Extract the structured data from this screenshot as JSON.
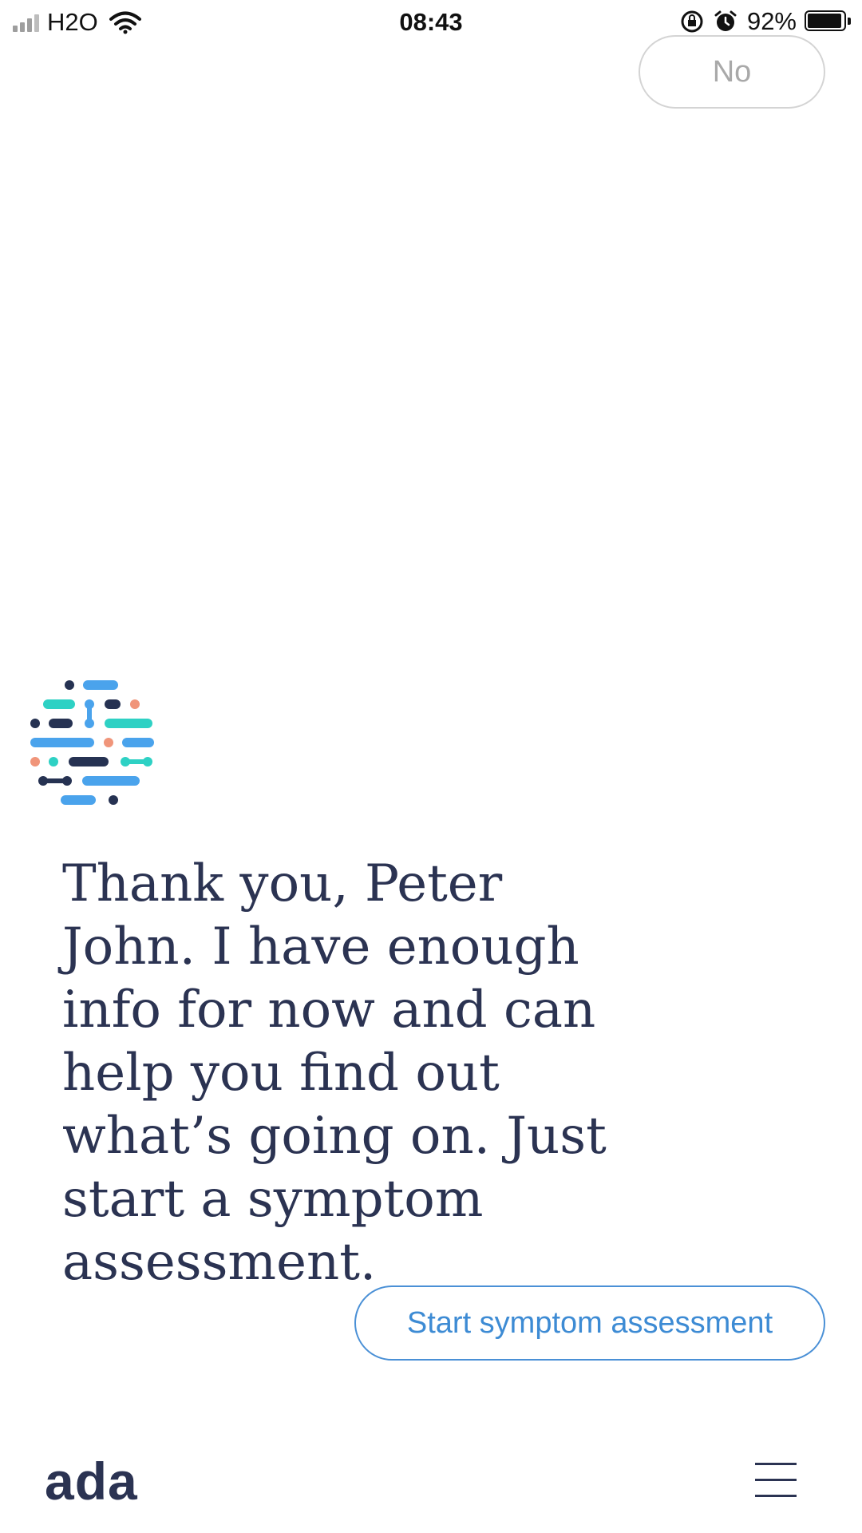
{
  "status_bar": {
    "carrier": "H2O",
    "time": "08:43",
    "battery": "92%",
    "battery_level": 0.92,
    "icons": [
      "signal-icon",
      "wifi-icon",
      "orientation-lock-icon",
      "alarm-icon",
      "battery-icon"
    ]
  },
  "chat": {
    "previous_answer": "No",
    "bot_message": "Thank you, Peter John. I have enough info for now and can help you find out what’s going on. Just start a symptom assessment."
  },
  "actions": {
    "start_assessment_label": "Start symptom assessment"
  },
  "footer": {
    "brand": "ada",
    "menu_icon": "hamburger-menu-icon"
  },
  "colors": {
    "text": "#2b3352",
    "accent": "#3d8bd4",
    "logo_teal": "#2ed1c4",
    "logo_blue": "#4aa3ec",
    "logo_navy": "#263252",
    "logo_salmon": "#f0957a"
  }
}
